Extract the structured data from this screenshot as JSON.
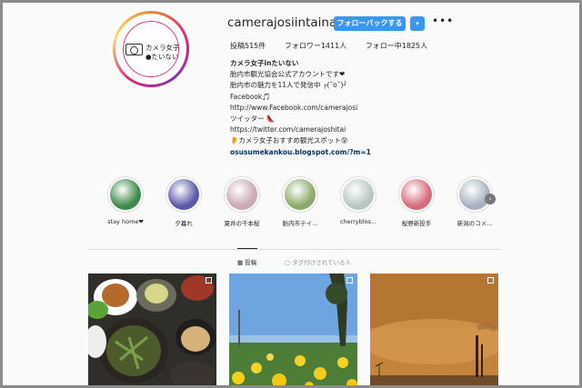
{
  "profile": {
    "username": "camerajosiintainai",
    "follow_label": "フォローバックする",
    "dropdown_label": "▾",
    "more_label": "•••",
    "avatar_text_line1": "カメラ女子",
    "avatar_text_line2": "●たいない"
  },
  "stats": {
    "posts": "投稿515件",
    "followers": "フォロワー1411人",
    "following": "フォロー中1825人"
  },
  "bio": {
    "name": "カメラ女子inたいない",
    "lines": [
      "胎内市観光協会公式アカウントです❤",
      "胎内市の魅力を11人で発信中 ┌(˘o˘)┘",
      "Facebook🎵",
      "http://www.Facebook.com/camerajosi",
      "ツイッター 👠",
      "https://twitter.com/camerajoshitai",
      "👂カメラ女子おすすめ観光スポット😵"
    ],
    "link": "osusumekankou.blogspot.com/?m=1"
  },
  "highlights": [
    {
      "label": "stay home❤",
      "color": "#3d8a4a"
    },
    {
      "label": "夕暮れ",
      "color": "#5b5aa8"
    },
    {
      "label": "夏井の千本桜",
      "color": "#c9a9b6"
    },
    {
      "label": "胎内市テイ...",
      "color": "#8cab6a"
    },
    {
      "label": "cherryblos...",
      "color": "#b9c7c0"
    },
    {
      "label": "桜野新投手",
      "color": "#d76b7c"
    },
    {
      "label": "新潟のコメ...",
      "color": "#a7b2c0"
    }
  ],
  "tabs": {
    "posts": "▦ 投稿",
    "tagged": "▢ タグ付けされている人"
  },
  "next_arrow": "›"
}
